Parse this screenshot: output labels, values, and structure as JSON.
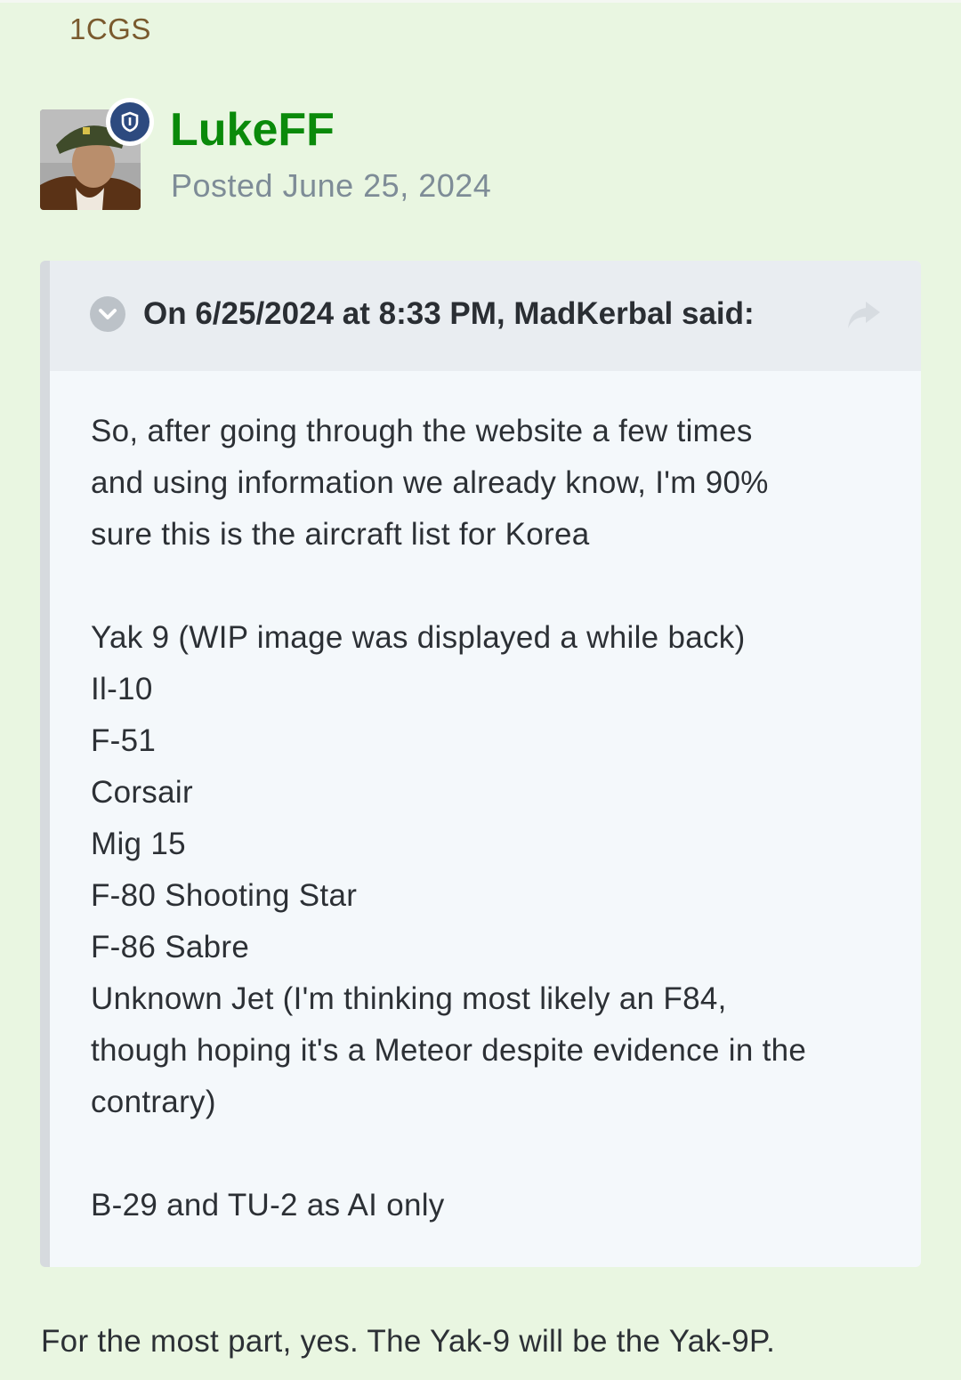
{
  "group_tag": "1CGS",
  "author": {
    "name": "LukeFF",
    "posted": "Posted June 25, 2024"
  },
  "quote": {
    "citation": "On 6/25/2024 at 8:33 PM, MadKerbal said:",
    "lines": {
      "intro1": "So, after going through the website a few times",
      "intro2": "and using information we already know, I'm 90%",
      "intro3": "sure this is the aircraft list for Korea",
      "yak9": "Yak 9 (WIP image was displayed a while back)",
      "il10": "Il-10",
      "f51": "F-51",
      "corsair": "Corsair",
      "mig15": "Mig 15",
      "f80": "F-80 Shooting Star",
      "f86": "F-86 Sabre",
      "unknown1": "Unknown Jet (I'm thinking most likely an F84,",
      "unknown2": "though hoping it's a Meteor despite evidence in the",
      "unknown3": "contrary)",
      "ai_only": "B-29 and TU-2 as AI only"
    }
  },
  "reply": "For the most part, yes. The Yak-9 will be the Yak-9P.",
  "icons": {
    "badge": "shield-icon",
    "collapse": "chevron-down-icon",
    "share": "share-arrow-icon"
  },
  "colors": {
    "background": "#e9f6e1",
    "author_name": "#0a8a0a",
    "group_tag": "#7a5a2e",
    "quote_bg": "#f4f8fb",
    "quote_header_bg": "#e9edf1"
  }
}
